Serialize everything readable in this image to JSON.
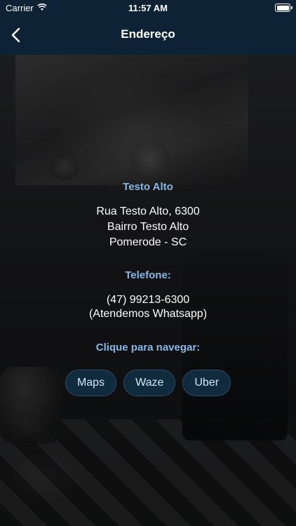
{
  "status_bar": {
    "carrier": "Carrier",
    "time": "11:57 AM"
  },
  "nav": {
    "title": "Endereço",
    "back_icon": "chevron-left-icon"
  },
  "location": {
    "name": "Testo Alto",
    "address_line1": "Rua Testo Alto, 6300",
    "address_line2": "Bairro Testo Alto",
    "address_line3": "Pomerode - SC"
  },
  "phone": {
    "label": "Telefone:",
    "number": "(47) 99213-6300",
    "note": "(Atendemos Whatsapp)"
  },
  "navigate": {
    "label": "Clique para navegar:",
    "buttons": [
      "Maps",
      "Waze",
      "Uber"
    ]
  },
  "colors": {
    "nav_bg": "#0e2236",
    "heading": "#86b8e6",
    "button_bg": "#102a3e"
  }
}
